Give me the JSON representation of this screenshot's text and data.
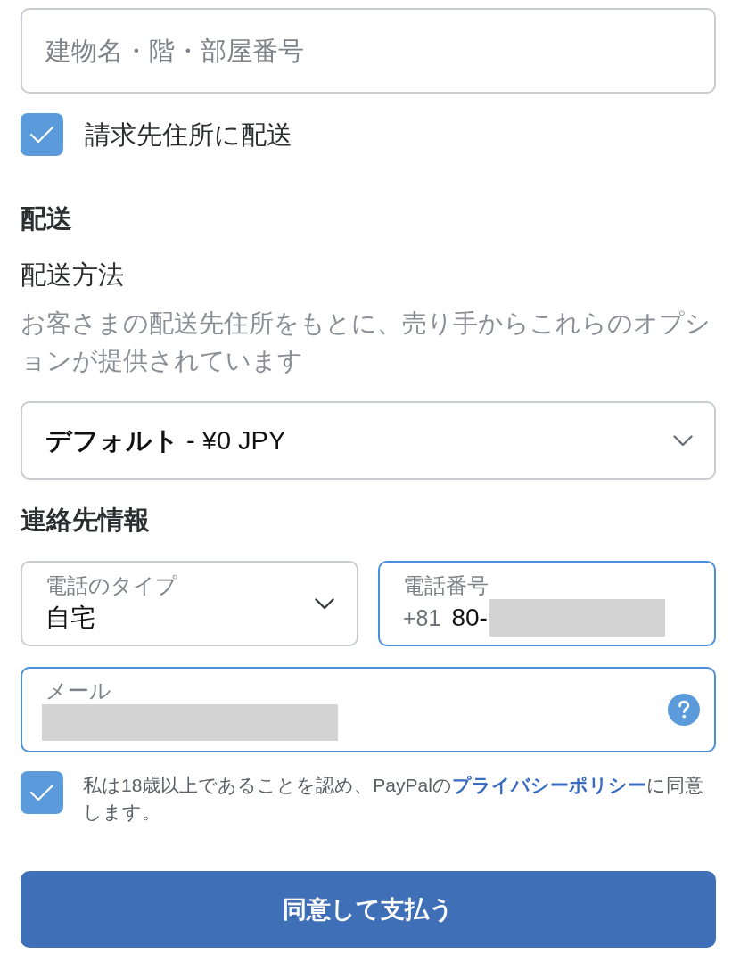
{
  "address_field": {
    "placeholder": "建物名・階・部屋番号"
  },
  "ship_to_billing": {
    "label": "請求先住所に配送",
    "checked": true
  },
  "shipping": {
    "heading": "配送",
    "method_label": "配送方法",
    "description": "お客さまの配送先住所をもとに、売り手からこれらのオプションが提供されています",
    "method_select": {
      "value": "**デフォルト** - ¥0 JPY"
    }
  },
  "contact": {
    "heading": "連絡先情報",
    "phone_type": {
      "label": "電話のタイプ",
      "value": "自宅",
      "focused": false
    },
    "phone_number": {
      "label": "電話番号",
      "prefix": "+81",
      "value": "80-",
      "redacted": true,
      "focused": true
    },
    "email": {
      "label": "メール",
      "redacted": true,
      "focused": true
    }
  },
  "consent": {
    "checked": true,
    "text_before": "私は18歳以上であることを認め、PayPalの",
    "link": "プライバシーポリシー",
    "text_after": "に同意します。"
  },
  "submit_button": {
    "label": "同意して支払う"
  }
}
